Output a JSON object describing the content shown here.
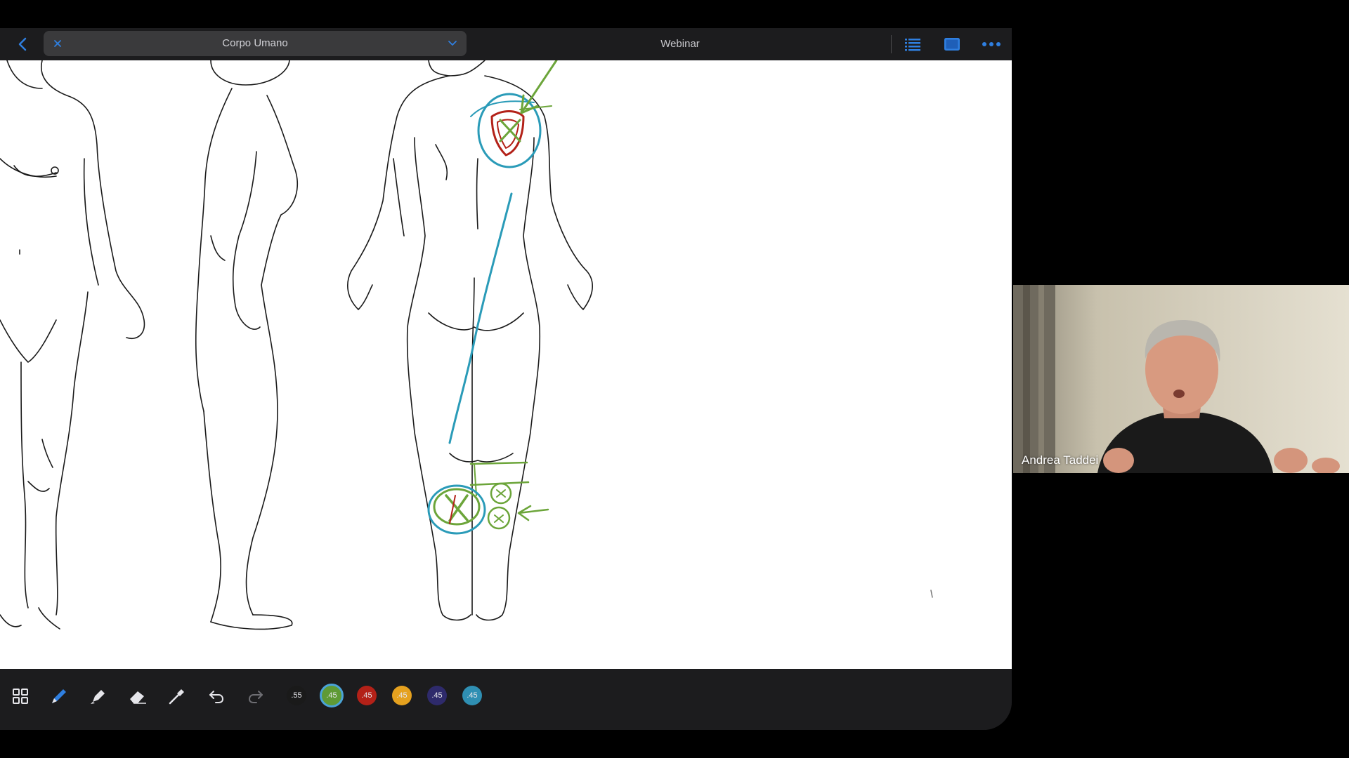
{
  "topbar": {
    "document_title": "Corpo Umano",
    "center_title": "Webinar"
  },
  "icons": {
    "back": "chevron-left-icon",
    "close": "close-icon",
    "dropdown": "chevron-down-icon",
    "outline": "list-icon",
    "view": "screen-icon",
    "more": "more-icon"
  },
  "toolbar": {
    "tools": [
      "grid-icon",
      "pen-icon",
      "highlighter-icon",
      "eraser-icon",
      "lasso-icon",
      "undo-icon",
      "redo-icon"
    ],
    "swatches": [
      {
        "label": ".55",
        "color": "#1a1a1a"
      },
      {
        "label": ".45",
        "color": "#5f9a35",
        "selected": true
      },
      {
        "label": ".45",
        "color": "#b32118"
      },
      {
        "label": ".45",
        "color": "#e5a11f"
      },
      {
        "label": ".45",
        "color": "#2e2a6b"
      },
      {
        "label": ".45",
        "color": "#2f8fb3"
      }
    ]
  },
  "annotation_colors": {
    "green": "#6ca53a",
    "blue": "#2a9bb8",
    "red": "#b32118"
  },
  "video": {
    "participant_name": "Andrea Taddei"
  }
}
